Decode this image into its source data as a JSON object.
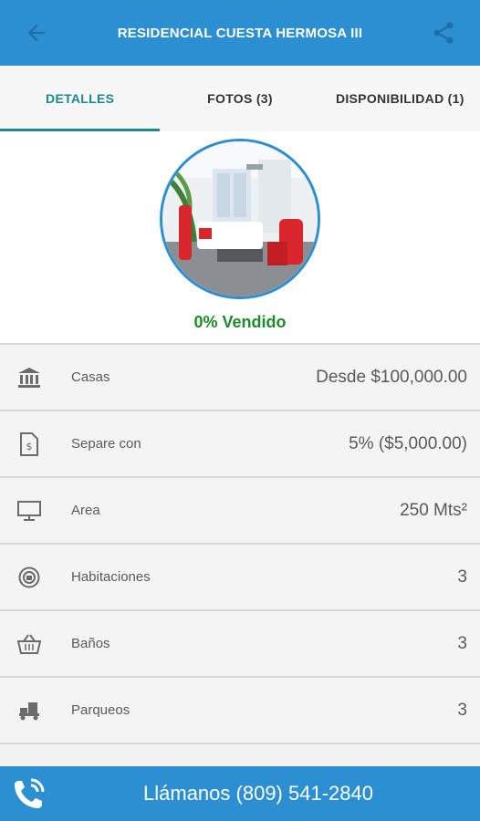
{
  "header": {
    "title": "RESIDENCIAL CUESTA HERMOSA III",
    "back_icon": "arrow-back-icon",
    "share_icon": "share-icon"
  },
  "tabs": [
    {
      "label": "DETALLES",
      "active": true
    },
    {
      "label": "FOTOS (3)",
      "active": false
    },
    {
      "label": "DISPONIBILIDAD (1)",
      "active": false
    }
  ],
  "hero": {
    "sold_text": "0% Vendido"
  },
  "details": [
    {
      "icon": "bank-icon",
      "label": "Casas",
      "value": "Desde $100,000.00"
    },
    {
      "icon": "price-tag-icon",
      "label": "Separe con",
      "value": "5% ($5,000.00)"
    },
    {
      "icon": "monitor-icon",
      "label": "Area",
      "value": "250 Mts²"
    },
    {
      "icon": "rooms-icon",
      "label": "Habitaciones",
      "value": "3"
    },
    {
      "icon": "basket-icon",
      "label": "Baños",
      "value": "3"
    },
    {
      "icon": "parking-icon",
      "label": "Parqueos",
      "value": "3"
    }
  ],
  "call": {
    "text": "Llámanos (809) 541-2840",
    "icon": "phone-icon"
  },
  "colors": {
    "primary": "#2b8fd1",
    "tab_active": "#1a8a8a",
    "sold": "#1f8a2a"
  }
}
